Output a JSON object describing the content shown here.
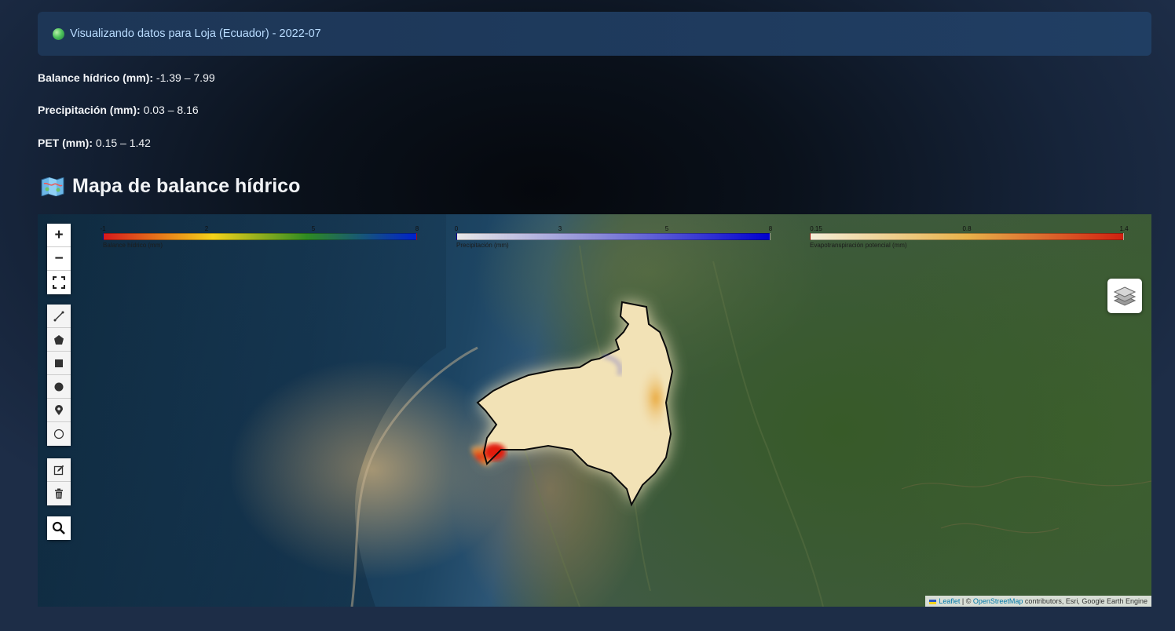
{
  "alert": {
    "icon": "green-circle-icon",
    "text": "Visualizando datos para Loja (Ecuador) - 2022-07"
  },
  "stats": [
    {
      "label": "Balance hídrico (mm):",
      "value": "-1.39 – 7.99"
    },
    {
      "label": "Precipitación (mm):",
      "value": "0.03 – 8.16"
    },
    {
      "label": "PET (mm):",
      "value": "0.15 – 1.42"
    }
  ],
  "heading": {
    "icon": "map-icon",
    "title": "Mapa de balance hídrico"
  },
  "map": {
    "zoom_in": "+",
    "zoom_out": "−",
    "fullscreen_icon": "fullscreen-icon",
    "draw_tools": [
      "polyline-icon",
      "polygon-icon",
      "rectangle-icon",
      "circle-icon",
      "marker-icon",
      "circlemarker-icon"
    ],
    "edit_tools": [
      "edit-icon",
      "trash-icon"
    ],
    "search_icon": "search-icon",
    "layers_icon": "layers-icon",
    "legends": [
      {
        "ticks": [
          "-1",
          "2",
          "5",
          "8"
        ],
        "caption": "Balance hídrico (mm)",
        "colors": [
          "#d7191c",
          "#f4d21a",
          "#2e8b22",
          "#0022cc"
        ]
      },
      {
        "ticks": [
          "0",
          "3",
          "5",
          "8"
        ],
        "caption": "Precipitación (mm)",
        "colors": [
          "#e8e8e8",
          "#8b8bd8",
          "#0000d0"
        ]
      },
      {
        "ticks": [
          "0.15",
          "0.8",
          "1.4"
        ],
        "caption": "Evapotranspiración potencial (mm)",
        "colors": [
          "#f4edd6",
          "#e8b24a",
          "#d02010"
        ]
      }
    ],
    "attribution": {
      "leaflet": "Leaflet",
      "sep": " | © ",
      "osm": "OpenStreetMap",
      "rest": " contributors, Esri, Google Earth Engine"
    }
  }
}
